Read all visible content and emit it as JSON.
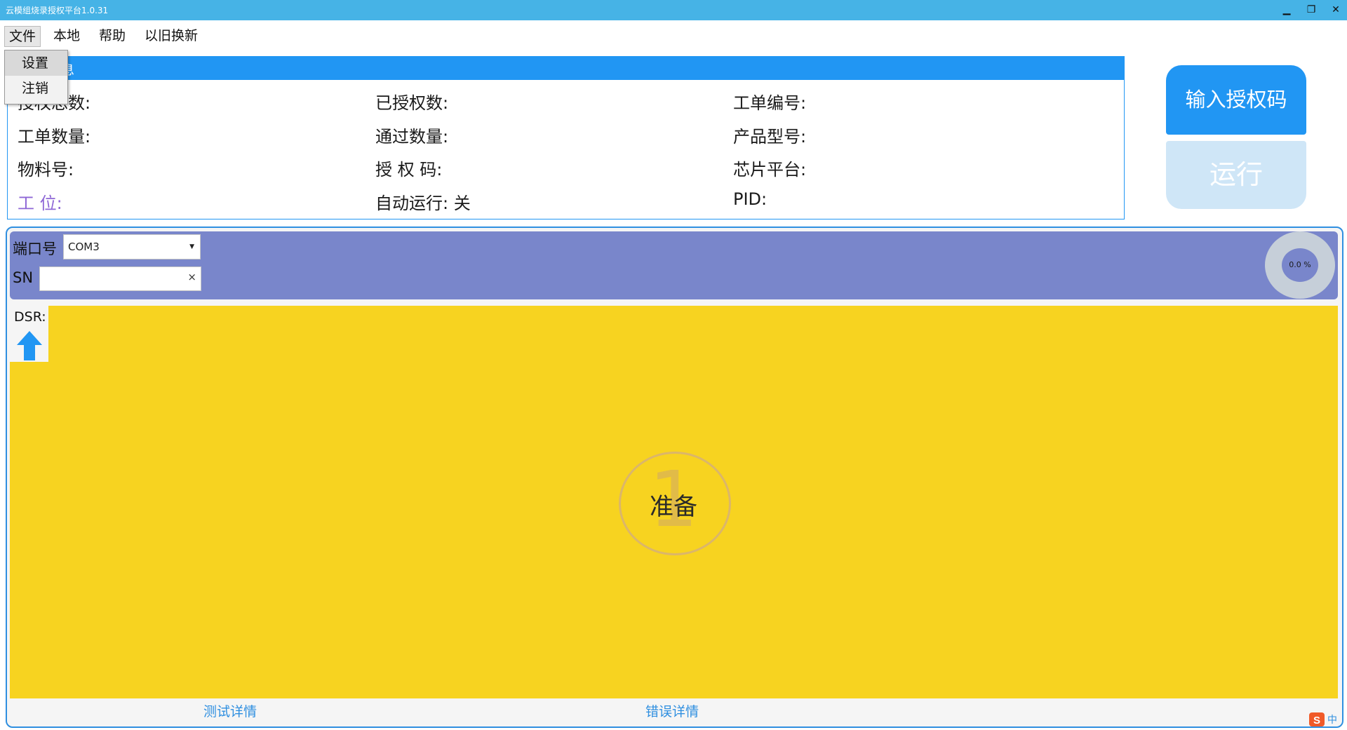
{
  "window": {
    "title": "云模组烧录授权平台1.0.31",
    "controls": {
      "minimize": "▁",
      "restore": "❐",
      "close": "✕"
    }
  },
  "menu": {
    "items": [
      "文件",
      "本地",
      "帮助",
      "以旧换新"
    ],
    "dropdown": [
      "设置",
      "注销"
    ]
  },
  "info": {
    "header_visible_char": "息",
    "fields": [
      "授权总数:",
      "已授权数:",
      "工单编号:",
      "工单数量:",
      "通过数量:",
      "产品型号:",
      "物料号:",
      "授 权 码:",
      "芯片平台:",
      "工 位:",
      "自动运行: 关",
      "PID:"
    ]
  },
  "buttons": {
    "auth": "输入授权码",
    "run": "运行"
  },
  "port": {
    "label": "端口号",
    "value": "COM3",
    "sn_label": "SN",
    "sn_value": "",
    "clear": "×",
    "progress": "0.0 %"
  },
  "dsr": {
    "label": "DSR:"
  },
  "status": {
    "number": "1",
    "text": "准备"
  },
  "tabs": [
    "测试详情",
    "错误详情"
  ],
  "ime": {
    "label": "中"
  },
  "colors": {
    "titlebar": "#46b3e6",
    "accent": "#2196f3",
    "port_bar": "#7986cb",
    "status_bg": "#f7d320",
    "run_disabled": "#cfe6f7"
  }
}
